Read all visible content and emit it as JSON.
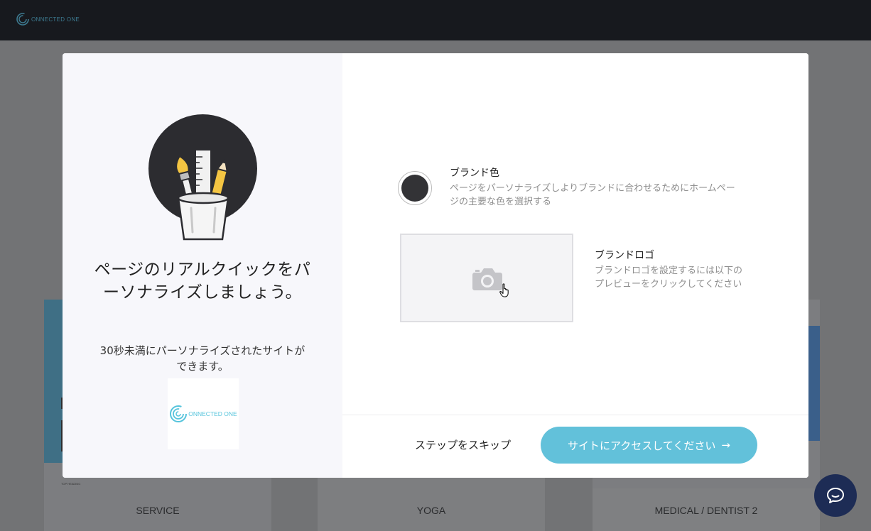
{
  "topbar": {
    "logo_text": "ONNECTED ONE"
  },
  "background_templates": [
    {
      "label": "SERVICE",
      "tiny_text": "TOP HEADING"
    },
    {
      "label": "YOGA"
    },
    {
      "label": "MEDICAL / DENTIST 2"
    }
  ],
  "modal": {
    "left": {
      "illustration_icon": "pencil-cup-icon",
      "headline": "ページのリアルクイックをパーソナライズしましょう。",
      "subtext": "30秒未満にパーソナライズされたサイトができます。",
      "logo_text": "ONNECTED ONE"
    },
    "brand_color": {
      "title": "ブランド色",
      "description": "ページをパーソナライズしよりブランドに合わせるためにホームページの主要な色を選択する",
      "value": "#333336"
    },
    "brand_logo": {
      "title": "ブランドロゴ",
      "description": "ブランドロゴを設定するには以下のプレビューをクリックしてください",
      "upload_icon": "camera-icon",
      "cursor_icon": "hand-pointer-icon"
    },
    "footer": {
      "skip_label": "ステップをスキップ",
      "cta_label": "サイトにアクセスしてください",
      "cta_arrow": "→"
    }
  },
  "chat": {
    "icon": "chat-icon"
  },
  "colors": {
    "accent": "#62c1da",
    "brand_logo": "#56c4dc",
    "chat": "#1d2c55"
  }
}
